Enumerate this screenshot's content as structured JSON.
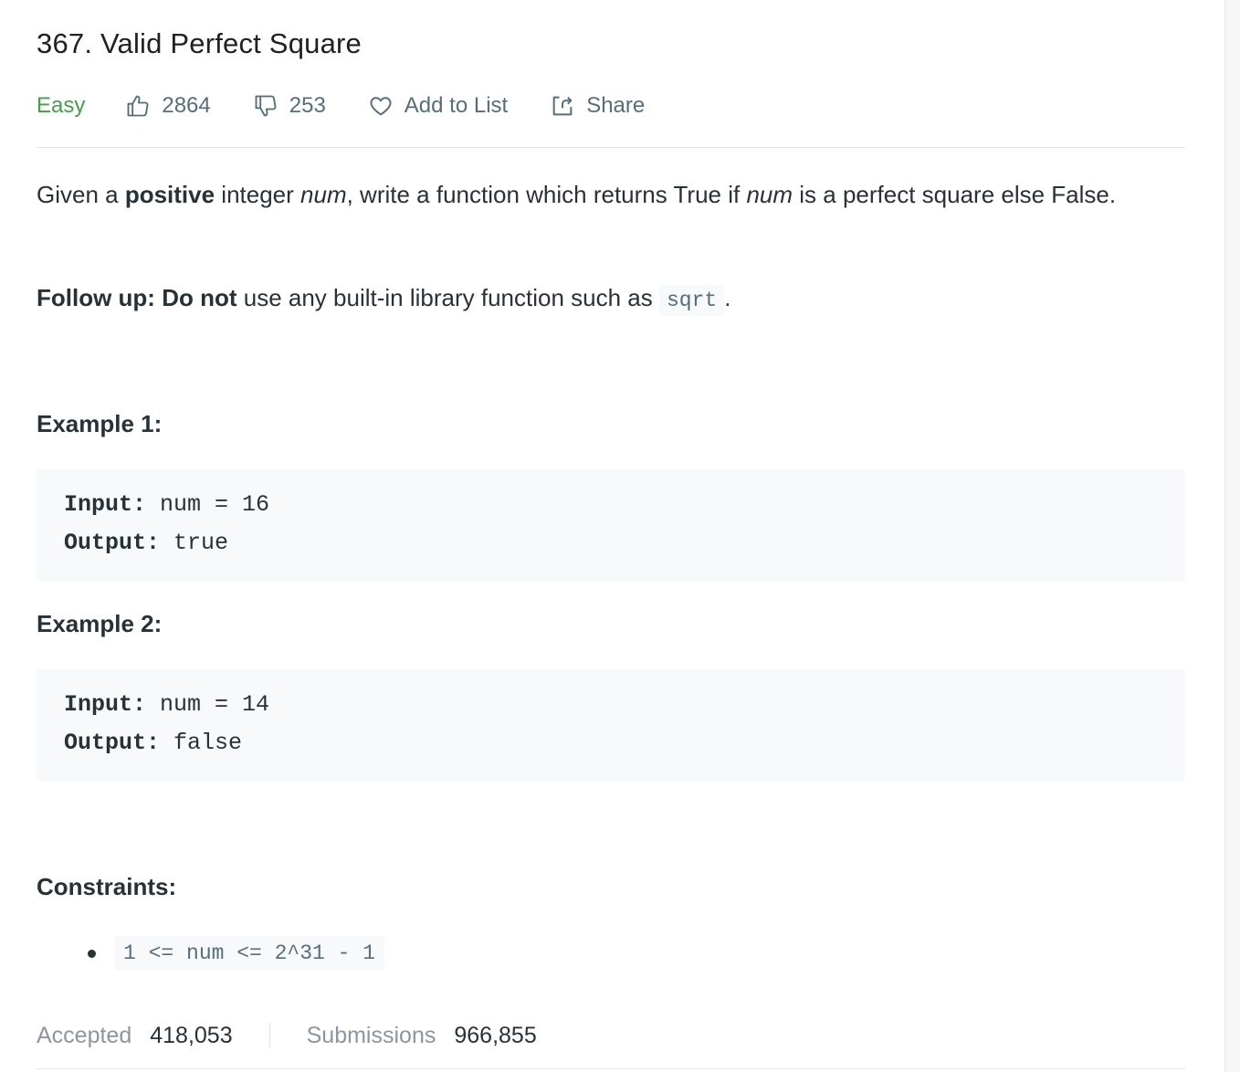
{
  "problem": {
    "title": "367. Valid Perfect Square",
    "difficulty": "Easy",
    "likes": "2864",
    "dislikes": "253",
    "add_to_list_label": "Add to List",
    "share_label": "Share"
  },
  "description": {
    "p1_a": "Given a ",
    "p1_bold": "positive",
    "p1_b": " integer ",
    "p1_var1": "num",
    "p1_c": ", write a function which returns True if ",
    "p1_var2": "num",
    "p1_d": " is a perfect square else False.",
    "followup_label": "Follow up:",
    "followup_bold": "Do not",
    "followup_text": " use any built-in library function such as ",
    "followup_code": "sqrt",
    "followup_end": "."
  },
  "examples": [
    {
      "heading": "Example 1:",
      "input_label": "Input:",
      "input_value": " num = 16",
      "output_label": "Output:",
      "output_value": " true"
    },
    {
      "heading": "Example 2:",
      "input_label": "Input:",
      "input_value": " num = 14",
      "output_label": "Output:",
      "output_value": " false"
    }
  ],
  "constraints": {
    "heading": "Constraints:",
    "items": [
      "1 <= num <= 2^31 - 1"
    ]
  },
  "stats": {
    "accepted_label": "Accepted",
    "accepted_value": "418,053",
    "submissions_label": "Submissions",
    "submissions_value": "966,855"
  },
  "colors": {
    "easy": "#43a047",
    "text": "#263238",
    "muted": "#546e7a",
    "code_bg": "#f7f9fa"
  }
}
